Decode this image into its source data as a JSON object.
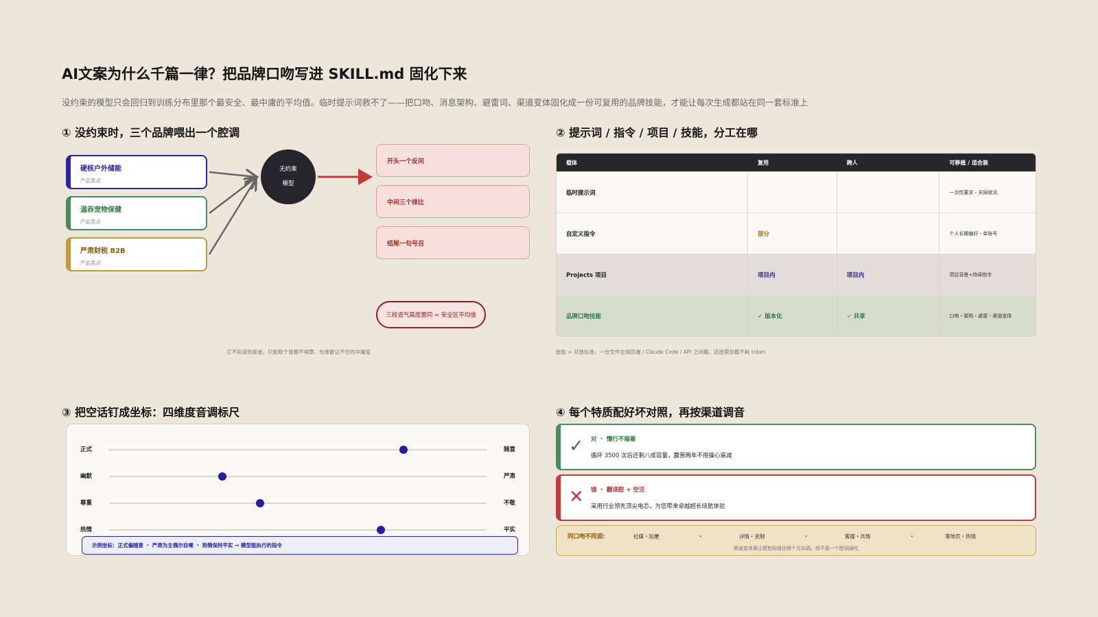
{
  "page": {
    "title": "AI文案为什么千篇一律？把品牌口吻写进 SKILL.md 固化下来",
    "subtitle": "没约束的模型只会回归到训练分布里那个最安全、最中庸的平均值。临时提示词救不了——把口吻、消息架构、避雷词、渠道变体固化成一份可复用的品牌技能，才能让每次生成都站在同一套标准上"
  },
  "panel1": {
    "title": "① 没约束时，三个品牌喂出一个腔调",
    "brands": [
      {
        "name": "硬核户外储能",
        "sub": "产品卖点",
        "color": "#2a259e"
      },
      {
        "name": "温吞宠物保健",
        "sub": "产品卖点",
        "color": "#2f7c45"
      },
      {
        "name": "严肃财税 B2B",
        "sub": "产品卖点",
        "color": "#8a5d12"
      }
    ],
    "model_line1": "无约束",
    "model_line2": "模型",
    "outputs": [
      "开头一个反问",
      "中间三个排比",
      "结尾一句号召"
    ],
    "result": "三段语气高度雷同 = 安全区平均值",
    "caption": "它不知道你是谁，只能取个谁都不得罪、也谁都记不住的中庸值"
  },
  "panel2": {
    "title": "② 提示词 / 指令 / 项目 / 技能，分工在哪",
    "headers": [
      "载体",
      "复用",
      "跨人",
      "可移植 / 适合装"
    ],
    "rows": [
      {
        "label": "临时提示词",
        "reuse": "",
        "share": "",
        "note": "一次性要求・关掉就没",
        "style": "white"
      },
      {
        "label": "自定义指令",
        "reuse": "部分",
        "share": "",
        "note": "个人长期偏好・单账号",
        "style": "white"
      },
      {
        "label": "Projects 项目",
        "reuse": "项目内",
        "share": "项目内",
        "note": "项目背景+持续指令",
        "style": "grey"
      },
      {
        "label": "品牌口吻技能",
        "reuse": "✓ 版本化",
        "share": "✓ 共享",
        "note": "口吻・架构・避雷・渠道变体",
        "style": "green"
      }
    ],
    "caption": "技能 = 开放标准，一份文件在网页端 / Claude Code / API 之间搬，还按需加载不耗 token"
  },
  "panel3": {
    "title": "③ 把空话钉成坐标：四维度音调标尺",
    "sliders": [
      {
        "left": "正式",
        "right": "随意",
        "value": 0.78
      },
      {
        "left": "幽默",
        "right": "严肃",
        "value": 0.3
      },
      {
        "left": "尊重",
        "right": "不敬",
        "value": 0.4
      },
      {
        "left": "热情",
        "right": "平实",
        "value": 0.72
      }
    ],
    "example": "示例坐标：正式偏随意 ・ 严肃为主偶尔自嘲 ・ 热情保持平实 → 模型能执行的指令"
  },
  "panel4": {
    "title": "④ 每个特质配好坏对照，再按渠道调音",
    "good": {
      "label": "对 ・ 懂行不端着",
      "text": "循环 3500 次后还剩八成容量，露营两年不用操心衰减"
    },
    "bad": {
      "label": "错 ・ 翻译腔 + 空泛",
      "text": "采用行业领先顶尖电芯，为您带来卓越超长续航体验"
    },
    "channels": {
      "label": "同口吻不同调:",
      "items": [
        "社媒・玩梗",
        "详情・克制",
        "客服・共情",
        "落地页・热情"
      ],
      "separator": "・",
      "note": "渠道变体表让模型知道往哪个方向调，而不是一个腔调通吃"
    }
  },
  "colors": {
    "background": "#ECE7DA",
    "navy": "#2a259e",
    "green": "#2f7c45",
    "gold": "#8a5d12",
    "red": "#c03a3a",
    "dark": "#25252b"
  }
}
